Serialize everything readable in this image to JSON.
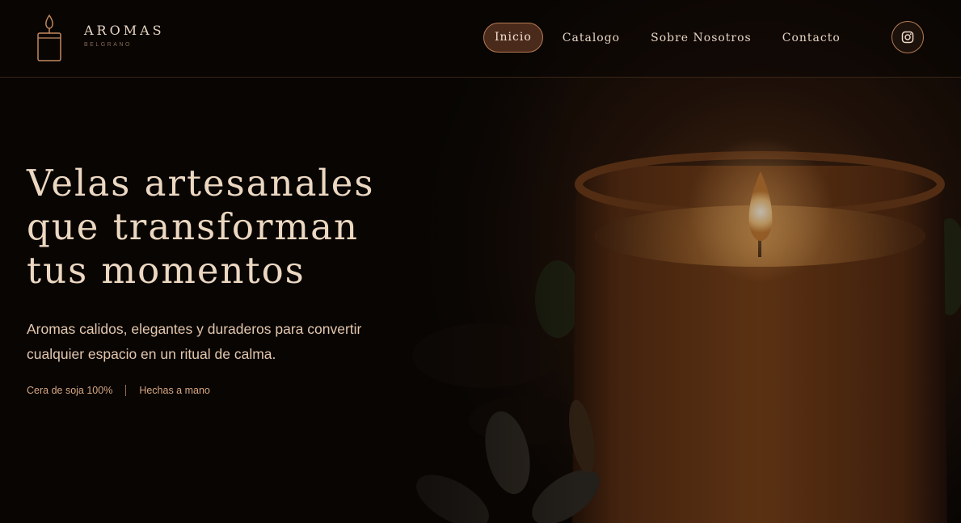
{
  "brand": {
    "name": "AROMAS",
    "subtitle": "BELGRANO",
    "logo_icon": "candle-icon"
  },
  "nav": {
    "items": [
      {
        "label": "Inicio",
        "active": true
      },
      {
        "label": "Catalogo",
        "active": false
      },
      {
        "label": "Sobre Nosotros",
        "active": false
      },
      {
        "label": "Contacto",
        "active": false
      }
    ],
    "social_icon": "instagram-icon"
  },
  "hero": {
    "title_lines": [
      "Velas artesanales",
      "que transforman",
      "tus momentos"
    ],
    "description_lines": [
      "Aromas calidos, elegantes y duraderos para convertir",
      "cualquier espacio en un ritual de calma."
    ],
    "tags": [
      "Cera de soja 100%",
      "Hechas a mano"
    ]
  },
  "colors": {
    "background": "#0d0806",
    "accent": "#b77c55",
    "active_nav_bg": "#4a2a1a",
    "title_text": "#ecd7c1",
    "body_text": "#e4c7ad",
    "tag_text": "#d9a882"
  }
}
